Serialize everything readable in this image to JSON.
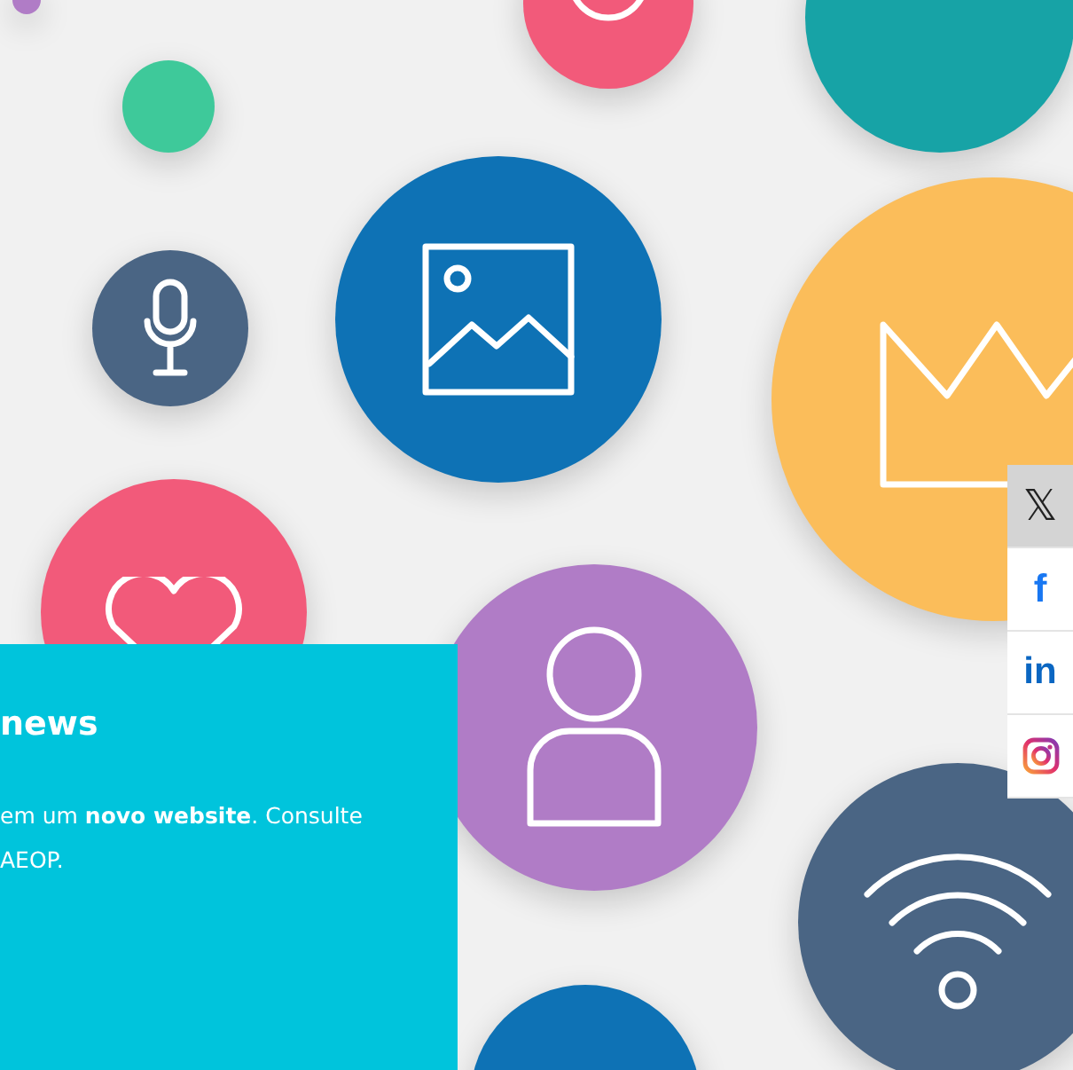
{
  "news_card": {
    "title": "news",
    "lines": [
      "em um **novo website**. Consulte",
      "AEOP."
    ]
  },
  "social_bar": [
    {
      "kind": "x",
      "label": "𝕏",
      "hovered": true
    },
    {
      "kind": "facebook",
      "label": "f",
      "hovered": false
    },
    {
      "kind": "linkedin",
      "label": "in",
      "hovered": false
    },
    {
      "kind": "instagram",
      "hovered": false
    }
  ]
}
